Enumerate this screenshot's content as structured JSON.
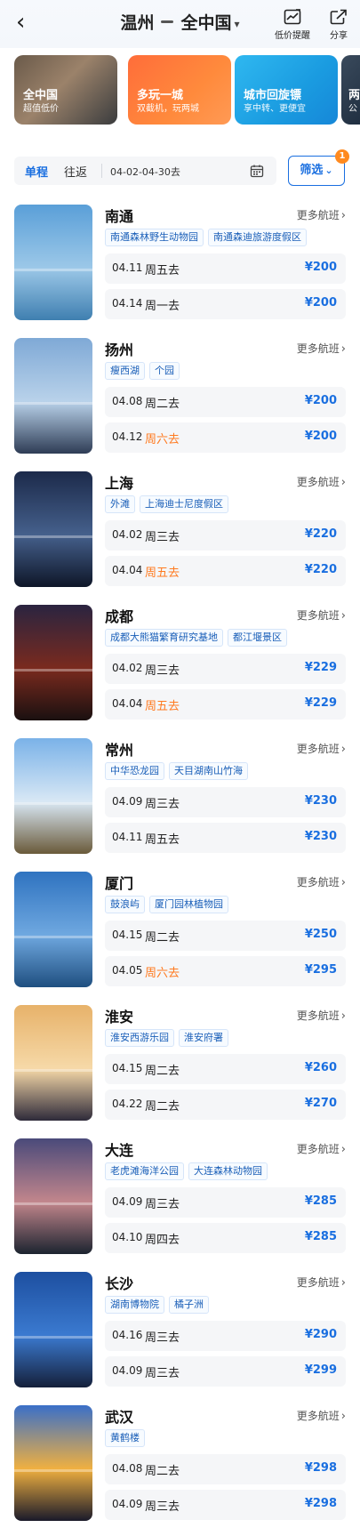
{
  "header": {
    "back_glyph": "‹",
    "from_city": "温州",
    "to_city": "全中国",
    "price_alert_label": "低价提醒",
    "share_label": "分享",
    "icons": [
      "back-arrow-icon",
      "trend-chart-icon",
      "share-icon",
      "chevron-down-icon"
    ]
  },
  "banners": [
    {
      "title": "全中国",
      "subtitle": "超值低价"
    },
    {
      "title": "多玩一城",
      "subtitle": "双截机，玩两城"
    },
    {
      "title": "城市回旋镖",
      "subtitle": "享中转、更便宜"
    },
    {
      "title": "两",
      "subtitle": "公"
    }
  ],
  "filter": {
    "oneway_label": "单程",
    "roundtrip_label": "往返",
    "date_range": "04-02-04-30去",
    "filter_label": "筛选",
    "filter_caret": "⌄",
    "filter_badge": "1"
  },
  "more_flights_label": "更多航班",
  "destinations": [
    {
      "city": "南通",
      "tags": [
        "南通森林野生动物园",
        "南通森迪旅游度假区"
      ],
      "flights": [
        {
          "date": "04.11",
          "weekday": "周五去",
          "price": "¥200"
        },
        {
          "date": "04.14",
          "weekday": "周一去",
          "price": "¥200"
        }
      ]
    },
    {
      "city": "扬州",
      "tags": [
        "瘦西湖",
        "个园"
      ],
      "flights": [
        {
          "date": "04.08",
          "weekday": "周二去",
          "price": "¥200"
        },
        {
          "date": "04.12",
          "weekday": "周六去",
          "price": "¥200"
        }
      ]
    },
    {
      "city": "上海",
      "tags": [
        "外滩",
        "上海迪士尼度假区"
      ],
      "flights": [
        {
          "date": "04.02",
          "weekday": "周三去",
          "price": "¥220"
        },
        {
          "date": "04.04",
          "weekday": "周五去",
          "price": "¥220"
        }
      ]
    },
    {
      "city": "成都",
      "tags": [
        "成都大熊猫繁育研究基地",
        "都江堰景区"
      ],
      "flights": [
        {
          "date": "04.02",
          "weekday": "周三去",
          "price": "¥229"
        },
        {
          "date": "04.04",
          "weekday": "周五去",
          "price": "¥229"
        }
      ]
    },
    {
      "city": "常州",
      "tags": [
        "中华恐龙园",
        "天目湖南山竹海"
      ],
      "flights": [
        {
          "date": "04.09",
          "weekday": "周三去",
          "price": "¥230"
        },
        {
          "date": "04.11",
          "weekday": "周五去",
          "price": "¥230"
        }
      ]
    },
    {
      "city": "厦门",
      "tags": [
        "鼓浪屿",
        "厦门园林植物园"
      ],
      "flights": [
        {
          "date": "04.15",
          "weekday": "周二去",
          "price": "¥250"
        },
        {
          "date": "04.05",
          "weekday": "周六去",
          "price": "¥295"
        }
      ]
    },
    {
      "city": "淮安",
      "tags": [
        "淮安西游乐园",
        "淮安府署"
      ],
      "flights": [
        {
          "date": "04.15",
          "weekday": "周二去",
          "price": "¥260"
        },
        {
          "date": "04.22",
          "weekday": "周二去",
          "price": "¥270"
        }
      ]
    },
    {
      "city": "大连",
      "tags": [
        "老虎滩海洋公园",
        "大连森林动物园"
      ],
      "flights": [
        {
          "date": "04.09",
          "weekday": "周三去",
          "price": "¥285"
        },
        {
          "date": "04.10",
          "weekday": "周四去",
          "price": "¥285"
        }
      ]
    },
    {
      "city": "长沙",
      "tags": [
        "湖南博物院",
        "橘子洲"
      ],
      "flights": [
        {
          "date": "04.16",
          "weekday": "周三去",
          "price": "¥290"
        },
        {
          "date": "04.09",
          "weekday": "周三去",
          "price": "¥299"
        }
      ]
    },
    {
      "city": "武汉",
      "tags": [
        "黄鹤楼"
      ],
      "flights": [
        {
          "date": "04.08",
          "weekday": "周二去",
          "price": "¥298"
        },
        {
          "date": "04.09",
          "weekday": "周三去",
          "price": "¥298"
        }
      ]
    }
  ],
  "colors": {
    "accent_blue": "#1a6fe0",
    "weekend_orange": "#ff7a1f",
    "badge_orange": "#ff8a1f"
  }
}
